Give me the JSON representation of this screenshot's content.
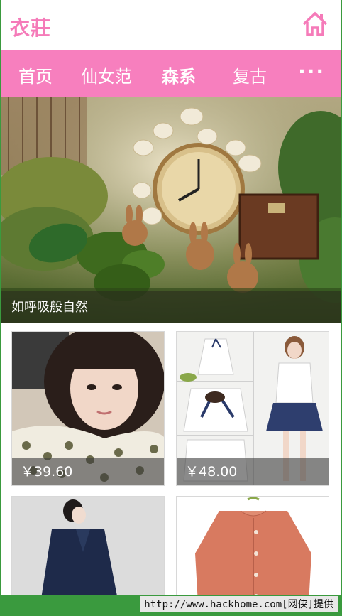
{
  "app": {
    "logo": "衣莊"
  },
  "nav": {
    "items": [
      {
        "label": "首页"
      },
      {
        "label": "仙女范"
      },
      {
        "label": "森系"
      },
      {
        "label": "复古"
      }
    ],
    "active_index": 2,
    "more_label": "···"
  },
  "hero": {
    "caption": "如呼吸般自然"
  },
  "products": [
    {
      "price": "￥39.60"
    },
    {
      "price": "￥48.00"
    },
    {
      "price": ""
    },
    {
      "price": ""
    }
  ],
  "watermark": "http://www.hackhome.com[网侠]提供",
  "colors": {
    "brand_pink": "#f77fbe",
    "logo_pink": "#f57bb9",
    "frame_green": "#3a9a3e"
  }
}
